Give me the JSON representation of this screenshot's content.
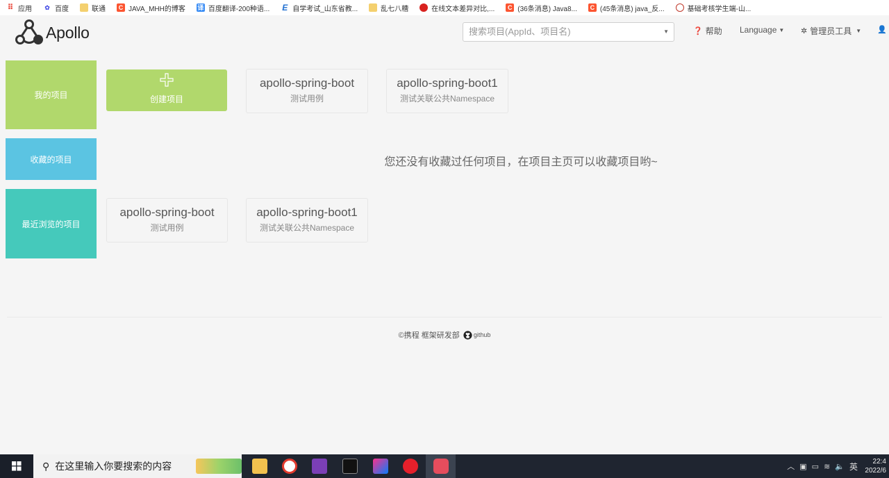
{
  "bookmarks": [
    {
      "label": "应用",
      "icon": "apps-grid-icon",
      "color": "#e94235"
    },
    {
      "label": "百度",
      "icon": "baidu-paw-icon",
      "color": "#2932e1"
    },
    {
      "label": "联通",
      "icon": "folder-icon",
      "color": "#f4c542"
    },
    {
      "label": "JAVA_MHH的博客",
      "icon": "csdn-c-icon",
      "color": "#fc5531"
    },
    {
      "label": "百度翻译-200种语...",
      "icon": "translate-icon",
      "color": "#3c8ef5"
    },
    {
      "label": "自学考试_山东省教...",
      "icon": "e-logo-icon",
      "color": "#1f6fd1"
    },
    {
      "label": "乱七八糟",
      "icon": "folder-icon",
      "color": "#f4c542"
    },
    {
      "label": "在线文本差异对比,...",
      "icon": "red-circle-icon",
      "color": "#d8221f"
    },
    {
      "label": "(36条消息) Java8...",
      "icon": "csdn-c-icon",
      "color": "#fc5531"
    },
    {
      "label": "(45条消息) java_反...",
      "icon": "csdn-c-icon",
      "color": "#fc5531"
    },
    {
      "label": "基础考核学生端-山...",
      "icon": "seal-icon",
      "color": "#c0392b"
    }
  ],
  "header": {
    "logo_text": "Apollo",
    "search_placeholder": "搜索项目(AppId、项目名)",
    "help": "帮助",
    "language": "Language",
    "admin_tools": "管理员工具"
  },
  "sections": {
    "my_projects": {
      "label": "我的项目",
      "color": "#b1d86c"
    },
    "favorites": {
      "label": "收藏的项目",
      "color": "#5bc4e2"
    },
    "recent": {
      "label": "最近浏览的项目",
      "color": "#45c9bb"
    }
  },
  "create_project": "创建项目",
  "my_projects": [
    {
      "name": "apollo-spring-boot",
      "desc": "测试用例"
    },
    {
      "name": "apollo-spring-boot1",
      "desc": "测试关联公共Namespace"
    }
  ],
  "favorites_empty": "您还没有收藏过任何项目，在项目主页可以收藏项目哟~",
  "recent_projects": [
    {
      "name": "apollo-spring-boot",
      "desc": "测试用例"
    },
    {
      "name": "apollo-spring-boot1",
      "desc": "测试关联公共Namespace"
    }
  ],
  "footer": {
    "copyright": "©携程 框架研发部",
    "github": "github"
  },
  "taskbar": {
    "search_placeholder": "在这里输入你要搜索的内容",
    "ime": "英",
    "time": "22:4",
    "date": "2022/6"
  }
}
